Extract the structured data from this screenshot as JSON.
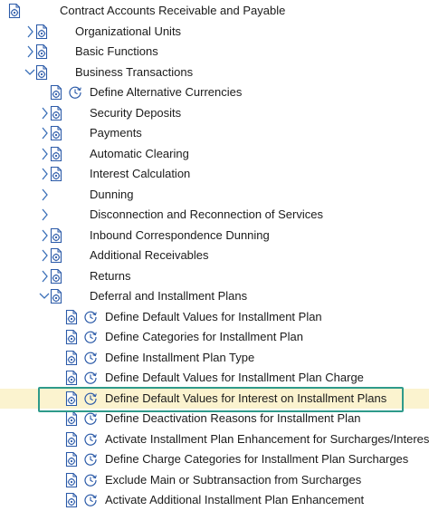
{
  "tree": {
    "root": {
      "label": "Contract Accounts Receivable and Payable",
      "state": "expanded"
    },
    "nodes": [
      {
        "label": "Organizational Units",
        "type": "folder",
        "state": "collapsed",
        "level": 1
      },
      {
        "label": "Basic Functions",
        "type": "folder",
        "state": "collapsed",
        "level": 1
      },
      {
        "label": "Business Transactions",
        "type": "folder",
        "state": "expanded",
        "level": 1
      },
      {
        "label": "Define Alternative Currencies",
        "type": "activity",
        "level": 2
      },
      {
        "label": "Security Deposits",
        "type": "folder",
        "state": "collapsed",
        "level": 2
      },
      {
        "label": "Payments",
        "type": "folder",
        "state": "collapsed",
        "level": 2
      },
      {
        "label": "Automatic Clearing",
        "type": "folder",
        "state": "collapsed",
        "level": 2
      },
      {
        "label": "Interest Calculation",
        "type": "folder",
        "state": "collapsed",
        "level": 2
      },
      {
        "label": "Dunning",
        "type": "plain",
        "state": "collapsed",
        "level": 2
      },
      {
        "label": "Disconnection and Reconnection of Services",
        "type": "plain",
        "state": "collapsed",
        "level": 2
      },
      {
        "label": "Inbound Correspondence Dunning",
        "type": "folder",
        "state": "collapsed",
        "level": 2
      },
      {
        "label": "Additional Receivables",
        "type": "folder",
        "state": "collapsed",
        "level": 2
      },
      {
        "label": "Returns",
        "type": "folder",
        "state": "collapsed",
        "level": 2
      },
      {
        "label": "Deferral and Installment Plans",
        "type": "folder",
        "state": "expanded",
        "level": 2
      },
      {
        "label": "Define Default Values for Installment Plan",
        "type": "activity",
        "level": 3
      },
      {
        "label": "Define Categories for Installment Plan",
        "type": "activity",
        "level": 3
      },
      {
        "label": "Define Installment Plan Type",
        "type": "activity",
        "level": 3
      },
      {
        "label": "Define Default Values for Installment Plan Charge",
        "type": "activity",
        "level": 3
      },
      {
        "label": "Define Default Values for Interest on Installment Plans",
        "type": "activity",
        "level": 3,
        "selected": true
      },
      {
        "label": "Define Deactivation Reasons for Installment Plan",
        "type": "activity",
        "level": 3
      },
      {
        "label": "Activate Installment Plan Enhancement for Surcharges/Interest",
        "type": "activity",
        "level": 3
      },
      {
        "label": "Define Charge Categories for Installment Plan Surcharges",
        "type": "activity",
        "level": 3
      },
      {
        "label": "Exclude Main or Subtransaction from Surcharges",
        "type": "activity",
        "level": 3
      },
      {
        "label": "Activate Additional Installment Plan Enhancement",
        "type": "activity",
        "level": 3
      }
    ]
  },
  "icons": {
    "expanded": "chevron-down-icon",
    "collapsed": "chevron-right-icon",
    "document": "document-icon",
    "execute": "clock-execute-icon"
  },
  "colors": {
    "chevron": "#3a6fb8",
    "icon": "#2b5aa8",
    "highlight_bg": "#fbf3cf",
    "focus_border": "#2e9a8a"
  }
}
